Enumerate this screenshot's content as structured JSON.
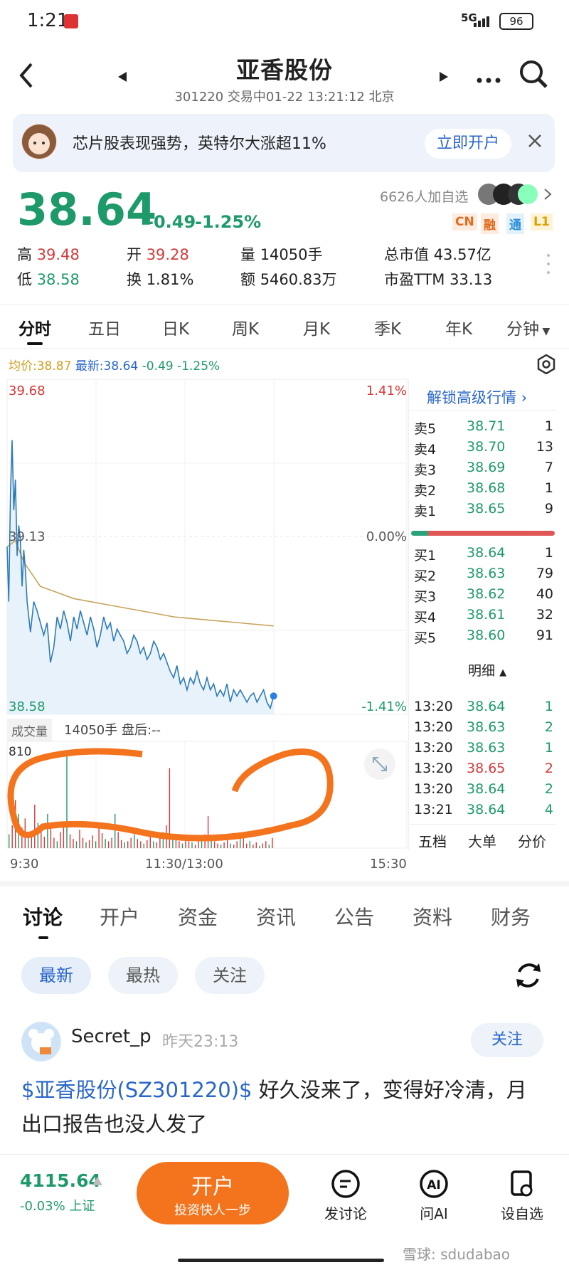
{
  "status": {
    "time": "1:21",
    "net": "5G",
    "battery": "96"
  },
  "header": {
    "title": "亚香股份",
    "subtitle": "301220 交易中01-22 13:21:12 北京"
  },
  "banner": {
    "text": "芯片股表现强势，英特尔大涨超11%",
    "button": "立即开户"
  },
  "quote": {
    "price": "38.64",
    "change": "-0.49",
    "pct": "-1.25%",
    "followers": "6626人加自选",
    "badges": [
      "CN",
      "融",
      "通",
      "L1"
    ],
    "high_label": "高",
    "high": "39.48",
    "open_label": "开",
    "open": "39.28",
    "vol_label": "量",
    "vol": "14050手",
    "mcap_label": "总市值",
    "mcap": "43.57亿",
    "low_label": "低",
    "low": "38.58",
    "turn_label": "换",
    "turn": "1.81%",
    "amt_label": "额",
    "amt": "5460.83万",
    "pe_label": "市盈TTM",
    "pe": "33.13"
  },
  "chart_tabs": [
    "分时",
    "五日",
    "日K",
    "周K",
    "月K",
    "季K",
    "年K",
    "分钟"
  ],
  "legend": {
    "avg": "均价:38.87",
    "latest": "最新:38.64",
    "chg": "-0.49",
    "pct": "-1.25%"
  },
  "axis": {
    "y_top": "39.68",
    "y_mid": "39.13",
    "y_bot": "38.58",
    "pct_top": "1.41%",
    "pct_mid": "0.00%",
    "pct_bot": "-1.41%",
    "vol_title": "成交量",
    "vol_val": "14050手",
    "after": "盘后:--",
    "vol_max": "810",
    "x_mid": "11:30/13:00",
    "x_end": "15:30",
    "x_start": "9:30"
  },
  "orderbook": {
    "unlock": "解锁高级行情",
    "asks": [
      {
        "l": "卖5",
        "p": "38.71",
        "v": "1"
      },
      {
        "l": "卖4",
        "p": "38.70",
        "v": "13"
      },
      {
        "l": "卖3",
        "p": "38.69",
        "v": "7"
      },
      {
        "l": "卖2",
        "p": "38.68",
        "v": "1"
      },
      {
        "l": "卖1",
        "p": "38.65",
        "v": "9"
      }
    ],
    "bids": [
      {
        "l": "买1",
        "p": "38.64",
        "v": "1"
      },
      {
        "l": "买2",
        "p": "38.63",
        "v": "79"
      },
      {
        "l": "买3",
        "p": "38.62",
        "v": "40"
      },
      {
        "l": "买4",
        "p": "38.61",
        "v": "32"
      },
      {
        "l": "买5",
        "p": "38.60",
        "v": "91"
      }
    ],
    "detail": "明细",
    "trades": [
      {
        "t": "13:20",
        "p": "38.64",
        "v": "1"
      },
      {
        "t": "13:20",
        "p": "38.63",
        "v": "2"
      },
      {
        "t": "13:20",
        "p": "38.63",
        "v": "1"
      },
      {
        "t": "13:20",
        "p": "38.65",
        "v": "2"
      },
      {
        "t": "13:20",
        "p": "38.64",
        "v": "2"
      },
      {
        "t": "13:21",
        "p": "38.64",
        "v": "4"
      }
    ],
    "tabs": [
      "五档",
      "大单",
      "分价"
    ]
  },
  "chart_data": {
    "type": "line",
    "title": "",
    "y_range": [
      38.58,
      39.68
    ],
    "prev_close": 39.13,
    "x_range_minutes": [
      0,
      240
    ],
    "price": [
      [
        0,
        39.13
      ],
      [
        1,
        38.95
      ],
      [
        2,
        39.3
      ],
      [
        3,
        39.48
      ],
      [
        4,
        39.25
      ],
      [
        5,
        39.35
      ],
      [
        6,
        39.1
      ],
      [
        7,
        39.2
      ],
      [
        8,
        39.15
      ],
      [
        9,
        39.0
      ],
      [
        10,
        39.12
      ],
      [
        11,
        39.05
      ],
      [
        12,
        38.95
      ],
      [
        14,
        38.85
      ],
      [
        16,
        38.95
      ],
      [
        18,
        38.92
      ],
      [
        20,
        38.88
      ],
      [
        22,
        38.84
      ],
      [
        24,
        38.88
      ],
      [
        25,
        38.82
      ],
      [
        26,
        38.75
      ],
      [
        28,
        38.8
      ],
      [
        30,
        38.9
      ],
      [
        32,
        38.86
      ],
      [
        34,
        38.92
      ],
      [
        36,
        38.88
      ],
      [
        38,
        38.82
      ],
      [
        40,
        38.9
      ],
      [
        42,
        38.86
      ],
      [
        44,
        38.92
      ],
      [
        46,
        38.88
      ],
      [
        48,
        38.84
      ],
      [
        50,
        38.9
      ],
      [
        52,
        38.86
      ],
      [
        54,
        38.8
      ],
      [
        56,
        38.84
      ],
      [
        58,
        38.9
      ],
      [
        60,
        38.86
      ],
      [
        62,
        38.88
      ],
      [
        64,
        38.82
      ],
      [
        66,
        38.86
      ],
      [
        68,
        38.84
      ],
      [
        70,
        38.82
      ],
      [
        72,
        38.78
      ],
      [
        74,
        38.8
      ],
      [
        76,
        38.84
      ],
      [
        78,
        38.82
      ],
      [
        80,
        38.78
      ],
      [
        82,
        38.8
      ],
      [
        84,
        38.76
      ],
      [
        86,
        38.78
      ],
      [
        88,
        38.82
      ],
      [
        90,
        38.8
      ],
      [
        92,
        38.76
      ],
      [
        94,
        38.78
      ],
      [
        96,
        38.75
      ],
      [
        98,
        38.72
      ],
      [
        100,
        38.7
      ],
      [
        102,
        38.74
      ],
      [
        104,
        38.68
      ],
      [
        106,
        38.7
      ],
      [
        108,
        38.66
      ],
      [
        110,
        38.7
      ],
      [
        112,
        38.68
      ],
      [
        114,
        38.72
      ],
      [
        116,
        38.68
      ],
      [
        118,
        38.66
      ],
      [
        120,
        38.7
      ],
      [
        122,
        38.66
      ],
      [
        124,
        38.68
      ],
      [
        126,
        38.64
      ],
      [
        128,
        38.66
      ],
      [
        130,
        38.64
      ],
      [
        132,
        38.68
      ],
      [
        134,
        38.62
      ],
      [
        136,
        38.66
      ],
      [
        138,
        38.64
      ],
      [
        140,
        38.66
      ],
      [
        142,
        38.64
      ],
      [
        144,
        38.62
      ],
      [
        146,
        38.64
      ],
      [
        148,
        38.65
      ],
      [
        150,
        38.62
      ],
      [
        152,
        38.64
      ],
      [
        154,
        38.66
      ],
      [
        156,
        38.62
      ],
      [
        158,
        38.6
      ],
      [
        160,
        38.64
      ]
    ],
    "avg": [
      [
        0,
        39.13
      ],
      [
        5,
        39.15
      ],
      [
        10,
        39.08
      ],
      [
        20,
        39.0
      ],
      [
        30,
        38.98
      ],
      [
        40,
        38.96
      ],
      [
        60,
        38.94
      ],
      [
        80,
        38.92
      ],
      [
        100,
        38.9
      ],
      [
        120,
        38.89
      ],
      [
        140,
        38.88
      ],
      [
        160,
        38.87
      ]
    ],
    "volume_max": 810,
    "volume": [
      120,
      200,
      420,
      300,
      180,
      260,
      90,
      150,
      380,
      220,
      140,
      100,
      300,
      180,
      90,
      60,
      140,
      200,
      810,
      120,
      80,
      60,
      160,
      90,
      50,
      70,
      110,
      60,
      200,
      130,
      80,
      60,
      90,
      300,
      140,
      70,
      50,
      60,
      90,
      120,
      80,
      60,
      40,
      70,
      100,
      60,
      50,
      90,
      140,
      200,
      700,
      120,
      80,
      60,
      40,
      90,
      60,
      50,
      30,
      60,
      80,
      120,
      280,
      100,
      60,
      40,
      30,
      50,
      70,
      40,
      30,
      60,
      90,
      130,
      40,
      60,
      30,
      50,
      20,
      40,
      60,
      30,
      90
    ]
  },
  "content_tabs": [
    "讨论",
    "开户",
    "资金",
    "资讯",
    "公告",
    "资料",
    "财务"
  ],
  "filters": [
    "最新",
    "最热",
    "关注"
  ],
  "post": {
    "user": "Secret_p",
    "time": "昨天23:13",
    "follow": "关注",
    "tag": "$亚香股份(SZ301220)$",
    "text1": " 好久没来了，变得好冷清，月",
    "text2": "出口报告也没人发了"
  },
  "bottom": {
    "index": "4115.64",
    "index_chg": "-0.03% 上证",
    "open_main": "开户",
    "open_sub": "投资快人一步",
    "b1": "发讨论",
    "b2": "问AI",
    "b3": "设自选",
    "watermark": "雪球: sdudabao"
  },
  "colors": {
    "up": "#d43a3a",
    "down": "#1e9a6a",
    "accent": "#2a66c9",
    "orange": "#f4731d"
  }
}
